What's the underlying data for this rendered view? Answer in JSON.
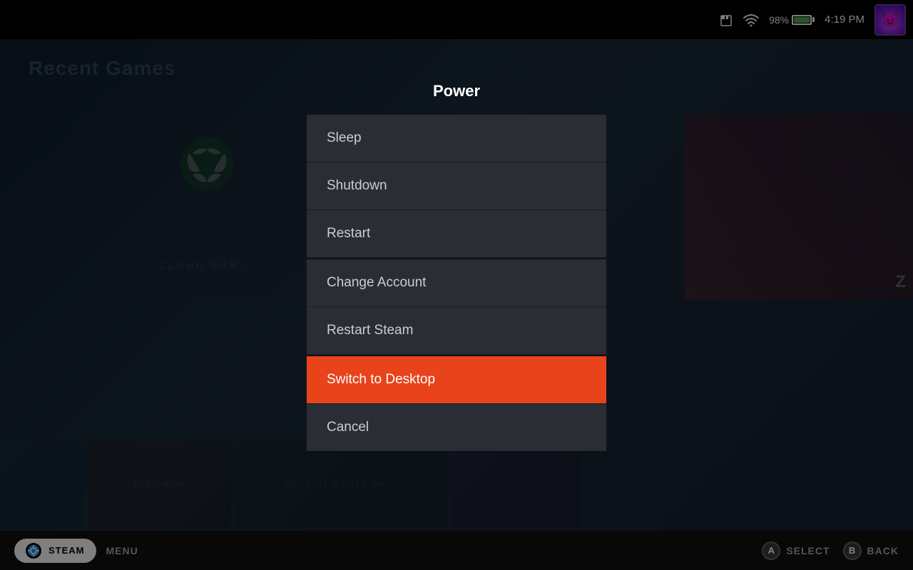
{
  "statusBar": {
    "battery_percent": "98%",
    "time": "4:19 PM"
  },
  "background": {
    "title": "Recent Games"
  },
  "dialog": {
    "title": "Power",
    "items": [
      {
        "id": "sleep",
        "label": "Sleep",
        "active": false,
        "separator": false
      },
      {
        "id": "shutdown",
        "label": "Shutdown",
        "active": false,
        "separator": false
      },
      {
        "id": "restart",
        "label": "Restart",
        "active": false,
        "separator": false
      },
      {
        "id": "change-account",
        "label": "Change Account",
        "active": false,
        "separator": true
      },
      {
        "id": "restart-steam",
        "label": "Restart Steam",
        "active": false,
        "separator": false
      },
      {
        "id": "switch-desktop",
        "label": "Switch to Desktop",
        "active": true,
        "separator": true
      },
      {
        "id": "cancel",
        "label": "Cancel",
        "active": false,
        "separator": false
      }
    ]
  },
  "bottomBar": {
    "steam_label": "STEAM",
    "menu_label": "MENU",
    "select_label": "SELECT",
    "back_label": "BACK",
    "a_button": "A",
    "b_button": "B"
  }
}
